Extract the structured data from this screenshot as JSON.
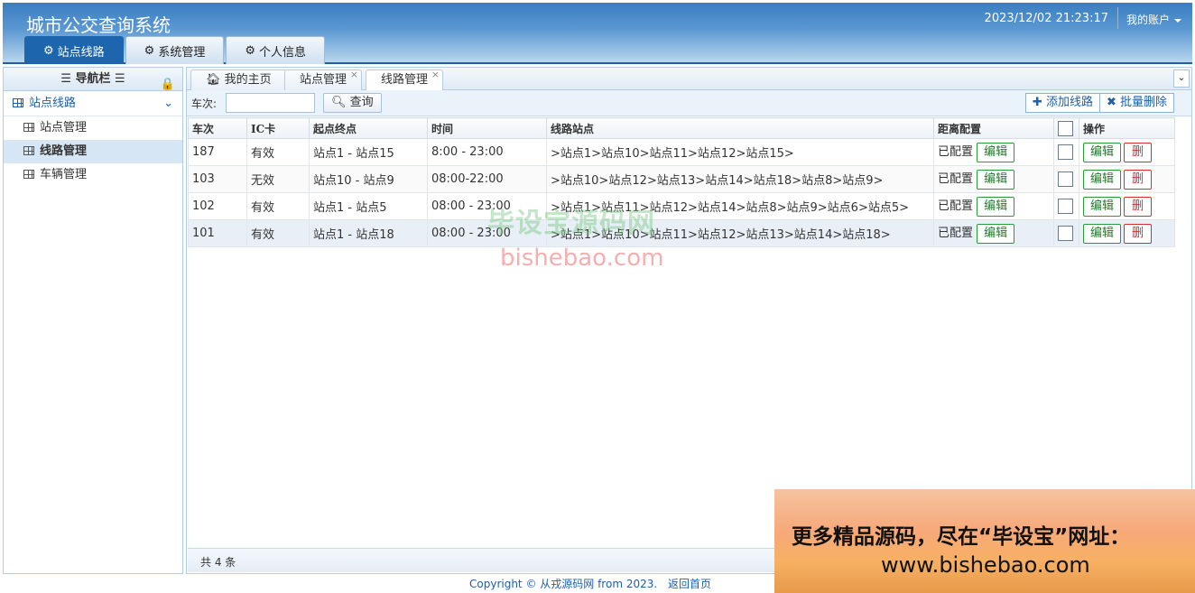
{
  "header": {
    "title": "城市公交查询系统",
    "datetime": "2023/12/02 21:23:17",
    "account": "我的账户",
    "tabs": [
      {
        "label": "站点线路",
        "icon": "gear-icon"
      },
      {
        "label": "系统管理",
        "icon": "gear-icon"
      },
      {
        "label": "个人信息",
        "icon": "gear-icon"
      }
    ]
  },
  "sidebar": {
    "title": "导航栏",
    "group": "站点线路",
    "items": [
      {
        "label": "站点管理"
      },
      {
        "label": "线路管理"
      },
      {
        "label": "车辆管理"
      }
    ]
  },
  "content_tabs": [
    {
      "label": "我的主页"
    },
    {
      "label": "站点管理"
    },
    {
      "label": "线路管理"
    }
  ],
  "toolbar": {
    "search_label": "车次:",
    "search_button": "查询",
    "add_button": "添加线路",
    "batch_delete_button": "批量删除"
  },
  "table": {
    "headers": [
      "车次",
      "IC卡",
      "起点终点",
      "时间",
      "线路站点",
      "距离配置",
      "操作"
    ],
    "rows": [
      {
        "no": "187",
        "ic": "有效",
        "ends": "站点1 - 站点15",
        "time": "8:00 - 23:00",
        "stops": ">站点1>站点10>站点11>站点12>站点15>",
        "dist": "已配置"
      },
      {
        "no": "103",
        "ic": "无效",
        "ends": "站点10 - 站点9",
        "time": "08:00-22:00",
        "stops": ">站点10>站点12>站点13>站点14>站点18>站点8>站点9>",
        "dist": "已配置"
      },
      {
        "no": "102",
        "ic": "有效",
        "ends": "站点1 - 站点5",
        "time": "08:00 - 23:00",
        "stops": ">站点1>站点11>站点12>站点14>站点8>站点9>站点6>站点5>",
        "dist": "已配置"
      },
      {
        "no": "101",
        "ic": "有效",
        "ends": "站点1 - 站点18",
        "time": "08:00 - 23:00",
        "stops": ">站点1>站点10>站点11>站点12>站点13>站点14>站点18>",
        "dist": "已配置"
      }
    ],
    "edit_label": "编辑",
    "delete_label": "删"
  },
  "footer": {
    "total": "共 4 条",
    "copyright": "Copyright © 从戎源码网 from 2023.",
    "home_link": "返回首页"
  },
  "watermark": {
    "line1": "毕设宝源码网",
    "line2": "bishebao.com"
  },
  "ad": {
    "line1": "更多精品源码，尽在“毕设宝”网址：",
    "line2": "www.bishebao.com"
  }
}
